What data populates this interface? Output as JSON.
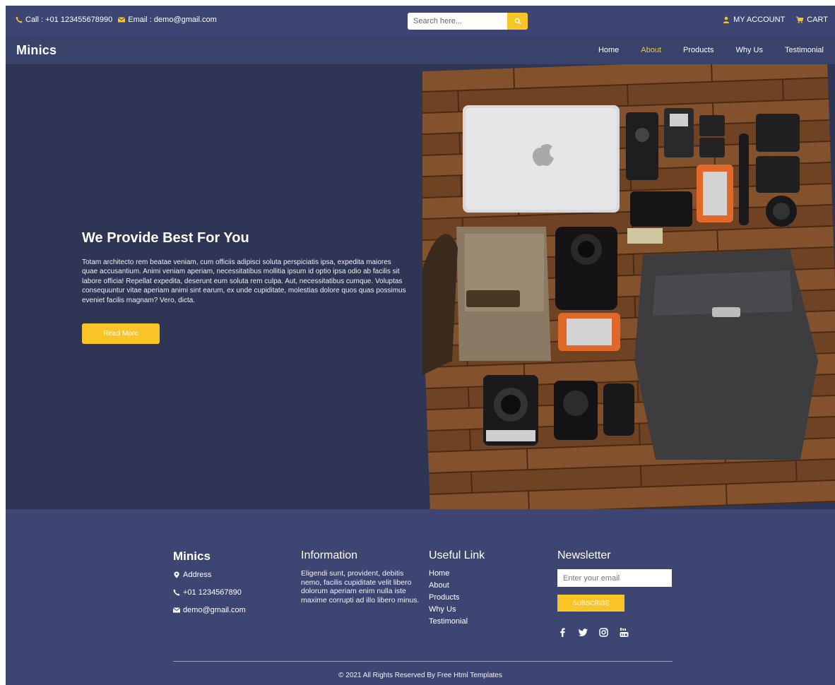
{
  "topbar": {
    "call": "Call : +01 123455678990",
    "email": "Email : demo@gmail.com",
    "search_placeholder": "Search here...",
    "account": "MY ACCOUNT",
    "cart": "CART"
  },
  "nav": {
    "brand": "Minics",
    "items": [
      "Home",
      "About",
      "Products",
      "Why Us",
      "Testimonial"
    ],
    "active": "About"
  },
  "hero": {
    "title": "We Provide Best For You",
    "text": "Totam architecto rem beatae veniam, cum officiis adipisci soluta perspiciatis ipsa, expedita maiores quae accusantium. Animi veniam aperiam, necessitatibus mollitia ipsum id optio ipsa odio ab facilis sit labore officia! Repellat expedita, deserunt eum soluta rem culpa. Aut, necessitatibus cumque. Voluptas consequuntur vitae aperiam animi sint earum, ex unde cupiditate, molestias dolore quos quas possimus eveniet facilis magnam? Vero, dicta.",
    "button": "Read More"
  },
  "footer": {
    "brand": "Minics",
    "address": "Address",
    "phone": "+01 1234567890",
    "email": "demo@gmail.com",
    "info_title": "Information",
    "info_text": "Eligendi sunt, provident, debitis nemo, facilis cupiditate velit libero dolorum aperiam enim nulla iste maxime corrupti ad illo libero minus.",
    "links_title": "Useful Link",
    "links": [
      "Home",
      "About",
      "Products",
      "Why Us",
      "Testimonial"
    ],
    "news_title": "Newsletter",
    "news_placeholder": "Enter your email",
    "subscribe": "SUBSCRIBE",
    "copyright": "© 2021 All Rights Reserved By Free Html Templates"
  },
  "colors": {
    "accent": "#f8c426",
    "topbar": "#3d4673",
    "nav": "#39426a",
    "hero": "#2f3554",
    "footer": "#3d4673"
  }
}
